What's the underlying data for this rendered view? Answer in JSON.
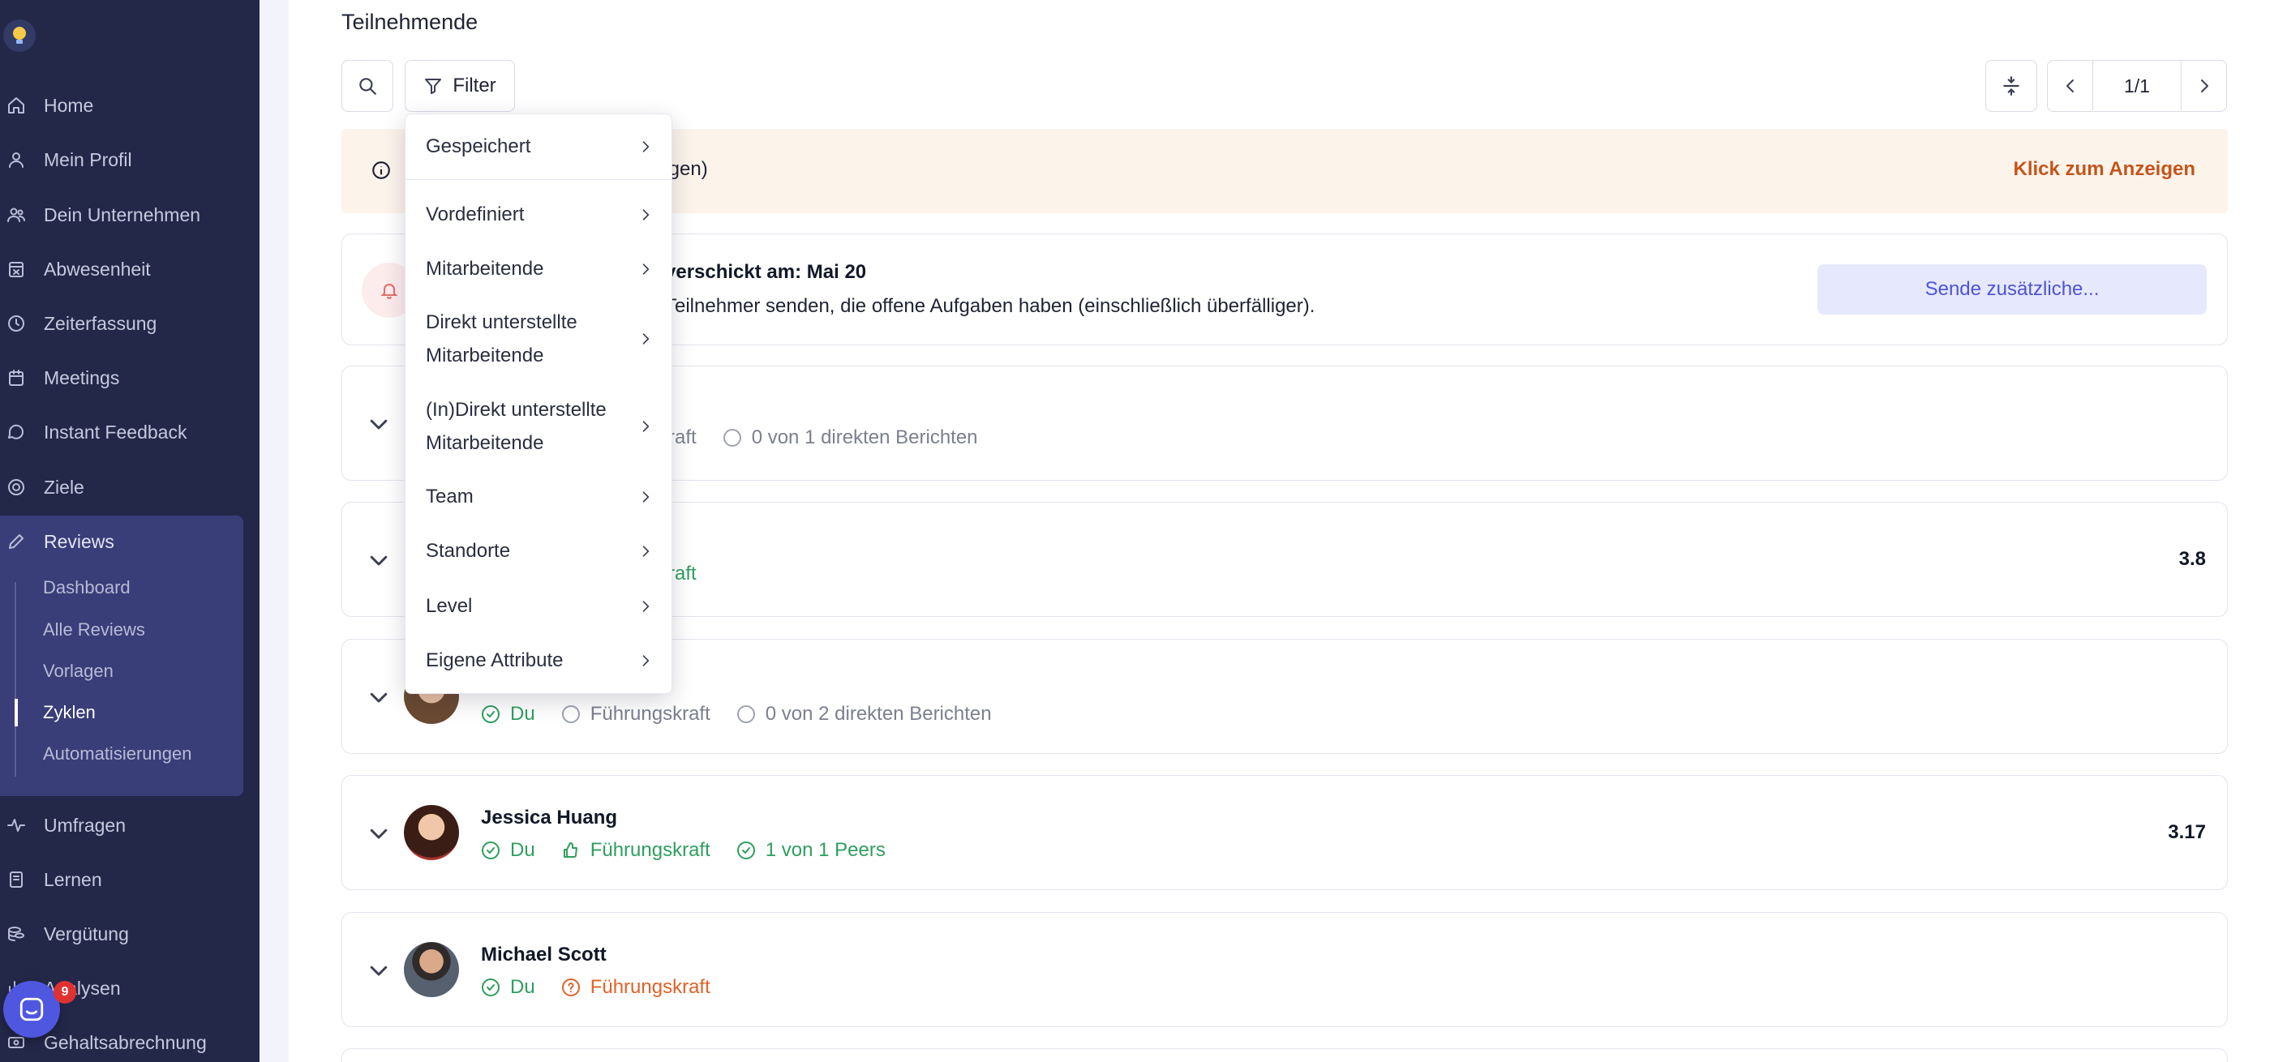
{
  "sidebar": {
    "items": [
      {
        "label": "Home",
        "icon": "home-icon"
      },
      {
        "label": "Mein Profil",
        "icon": "user-icon"
      },
      {
        "label": "Dein Unternehmen",
        "icon": "users-icon"
      },
      {
        "label": "Abwesenheit",
        "icon": "calendar-x-icon"
      },
      {
        "label": "Zeiterfassung",
        "icon": "clock-icon"
      },
      {
        "label": "Meetings",
        "icon": "calendar-icon"
      },
      {
        "label": "Instant Feedback",
        "icon": "message-icon"
      },
      {
        "label": "Ziele",
        "icon": "target-icon"
      },
      {
        "label": "Reviews",
        "icon": "pencil-icon"
      },
      {
        "label": "Umfragen",
        "icon": "pulse-icon"
      },
      {
        "label": "Lernen",
        "icon": "book-icon"
      },
      {
        "label": "Vergütung",
        "icon": "coins-icon"
      },
      {
        "label": "Analysen",
        "icon": "chart-icon"
      },
      {
        "label": "Gehaltsabrechnung",
        "icon": "payroll-icon"
      }
    ],
    "sub_items": [
      "Dashboard",
      "Alle Reviews",
      "Vorlagen",
      "Zyklen",
      "Automatisierungen"
    ],
    "active_sub": "Zyklen",
    "chat_badge": "9"
  },
  "main": {
    "section_title": "Teilnehmende",
    "filter_label": "Filter",
    "pagination": "1/1",
    "info_banner": {
      "text": "eigen)",
      "link": "Klick zum Anzeigen"
    },
    "reminder": {
      "title": "verschickt am: Mai 20",
      "desc": "Teilnehmer senden, die offene Aufgaben haben (einschließlich überfälliger).",
      "button": "Sende zusätzliche..."
    },
    "participants": [
      {
        "name": "",
        "statuses": [
          "kraft",
          "0 von 1 direkten Berichten"
        ],
        "score": ""
      },
      {
        "name": "",
        "statuses": [
          "kraft"
        ],
        "score": "3.8"
      },
      {
        "name": "",
        "statuses": [
          "Du",
          "Führungskraft",
          "0 von 2 direkten Berichten"
        ],
        "score": ""
      },
      {
        "name": "Jessica Huang",
        "statuses": [
          "Du",
          "Führungskraft",
          "1 von 1 Peers"
        ],
        "score": "3.17"
      },
      {
        "name": "Michael Scott",
        "statuses": [
          "Du",
          "Führungskraft"
        ],
        "score": ""
      }
    ]
  },
  "filter_menu": {
    "items": [
      "Gespeichert",
      "Vordefiniert",
      "Mitarbeitende",
      "Direkt unterstellte Mitarbeitende",
      "(In)Direkt unterstellte Mitarbeitende",
      "Team",
      "Standorte",
      "Level",
      "Eigene Attribute"
    ]
  },
  "colors": {
    "sidebar_bg": "#232849",
    "accent": "#4d54d6",
    "success": "#2f9e5f",
    "warning": "#e0622a",
    "link": "#c4551a"
  }
}
